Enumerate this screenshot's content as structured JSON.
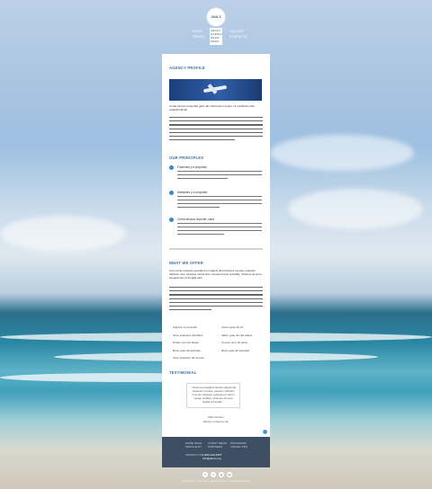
{
  "logo": {
    "text": "JUN 1"
  },
  "nav": {
    "home": "HOME",
    "travel": "TRAVEL",
    "about": "ABOUT",
    "about_sub": [
      "AGENCY",
      "NEWS",
      "TEAM"
    ],
    "gallery": "GALLERY",
    "contacts": "CONTACTS"
  },
  "agency_profile": {
    "title": "AGENCY PROFILE",
    "intro": "Cerba tempus imperdiet gavit dat indimentum neque. Ut vestibulum dat velandit blandit."
  },
  "principles": {
    "title": "OUR PRINCIPLES",
    "items": [
      {
        "title": "Fusientos y a propósito"
      },
      {
        "title": "Adelantes y a propósito"
      },
      {
        "title": "Cerba tempus imperdit -vanit"
      }
    ]
  },
  "offer": {
    "title": "WHAT WE OFFER",
    "intro": "Cum sociis natoque penatibus et magnis dis parturient montes, nascetur ridiculus mus. Quisque varius arcu. Aenean turpis convallis. Vivamus sit amet integula nisi, id fringilla nibh.",
    "col1": [
      "Figures ut vel deste",
      "Vene praesent doloribus",
      "Pudne cum dir allose",
      "Bene gras dir lanostas",
      "Vene praesent dit veneso"
    ],
    "col2": [
      "Vivero grae dir vil",
      "Zabro grae dir vita adese",
      "Comne cum dir alose",
      "Bene gras dir lanostad"
    ]
  },
  "testimonial": {
    "title": "TESTIMONIAL",
    "quote": "\" Vivamus penatibus blandit magnis dis parturient montes, nascetur ridiculus mus dui. Quisque vehicula eu rutrum integer sodales. Vivamus sit amet fingilla ut fringilla. \"",
    "author": "Mark Johnson",
    "author_role": "Director of Agency Ltd."
  },
  "footer": {
    "col1": [
      "HOME PAGE",
      "PROFILE MY"
    ],
    "col2": [
      "LATEST NEWS",
      "PARTNERS"
    ],
    "col3": [
      "PROGRAMS",
      "TRAVEL TIPS"
    ],
    "contact_label": "CONTACT US",
    "phone": "1-800-123-4567",
    "email": "info@demo.org",
    "socials": [
      "f",
      "t",
      "g",
      "in"
    ],
    "copyright": "Jun1 © 2013 · Privacy Policy · Website template by TemplateMonster.com"
  },
  "colors": {
    "accent": "#3f88c5",
    "footer_bg": "#3f4f63",
    "title": "#3c6fa6"
  }
}
